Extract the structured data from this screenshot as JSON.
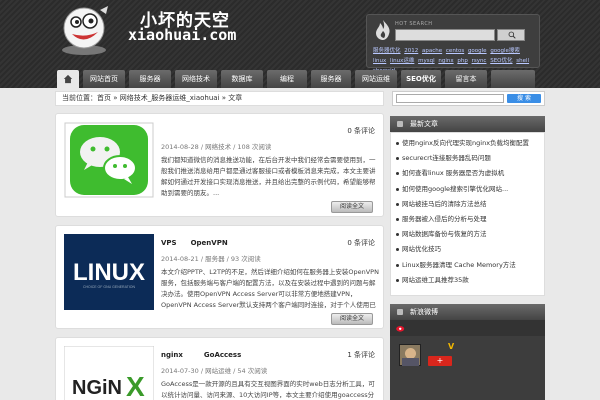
{
  "header": {
    "logo_cn": "小坏的天空",
    "logo_en": "xiaohuai.com",
    "search_label": "HOT SEARCH",
    "tags": [
      "服务器优化",
      "2012",
      "apache",
      "centos",
      "google",
      "google搜索",
      "linux",
      "linux运维",
      "mysql",
      "nginx",
      "php",
      "rsync",
      "SEO优化",
      "shell",
      "showsirl"
    ]
  },
  "nav": {
    "items": [
      "网站首页",
      "服务器",
      "网络技术",
      "数据库",
      "编程",
      "服务器",
      "网站运维",
      "SEO优化",
      "留言本"
    ]
  },
  "breadcrumb": {
    "text": "当前位置：首页 » 网络技术_服务器运维_xiaohuai » 文章"
  },
  "posts": [
    {
      "title": "",
      "comments": "0 条评论",
      "meta": "2014-08-28 / 网络技术 / 108 次阅读",
      "excerpt": "我们都知道微信的消息推送功能，在后台开发中我们经常会需要使用到，一般我们推送消息给用户都是通过客服接口或者模板消息来完成，本文主要讲解如何通过开发接口实现消息推送，并且给出完整的示例代码，希望能够帮助到需要的朋友。...",
      "more": "阅读全文"
    },
    {
      "title": "VPS　　OpenVPN",
      "comments": "0 条评论",
      "meta": "2014-08-21 / 服务器 / 93 次阅读",
      "excerpt": "本文介绍PPTP、L2TP的不足，然后详细介绍如何在服务器上安装OpenVPN服务，包括服务端与客户端的配置方法，以及在安装过程中遇到的问题与解决办法。使用OpenVPN Access Server可以非常方便地搭建VPN，OpenVPN Access Server默认支持两个客户端同时连接，对于个人使用已经完全OK了，安装过程简单易懂。",
      "more": "阅读全文"
    },
    {
      "title": "nginx　　　GoAccess",
      "comments": "1 条评论",
      "meta": "2014-07-30 / 网站运维 / 54 次阅读",
      "excerpt": "GoAccess是一款开源的且具有交互视图界面的实时web日志分析工具，可以统计访问量、访问来源、10大访问IP等，本文主要介绍使用goaccess分析nginx日志的方法。",
      "more": "阅读全文"
    }
  ],
  "sidebar": {
    "search_button": "搜 索",
    "recent_title": "最新文章",
    "recent": [
      "使用nginx反向代理实现nginx负载均衡配置",
      "securecrt连接服务器乱码问题",
      "如何查看linux 服务器是否为虚拟机",
      "如何使用google搜索引擎优化网站...",
      "网站被挂马后的清除方法总结",
      "服务器被入侵后的分析与处理",
      "网站数据库备份与恢复的方法",
      "网站优化技巧",
      "Linux服务器清理 Cache Memory方法",
      "网站运维工具推荐35款"
    ],
    "weibo_title": "新浪微博",
    "weibo_badge": "V",
    "weibo_follow": "+"
  },
  "colors": {
    "header_bg": "#2f2f2f",
    "nav_bg": "#555555",
    "accent_blue": "#3a8ee6",
    "follow_red": "#d9261c"
  }
}
